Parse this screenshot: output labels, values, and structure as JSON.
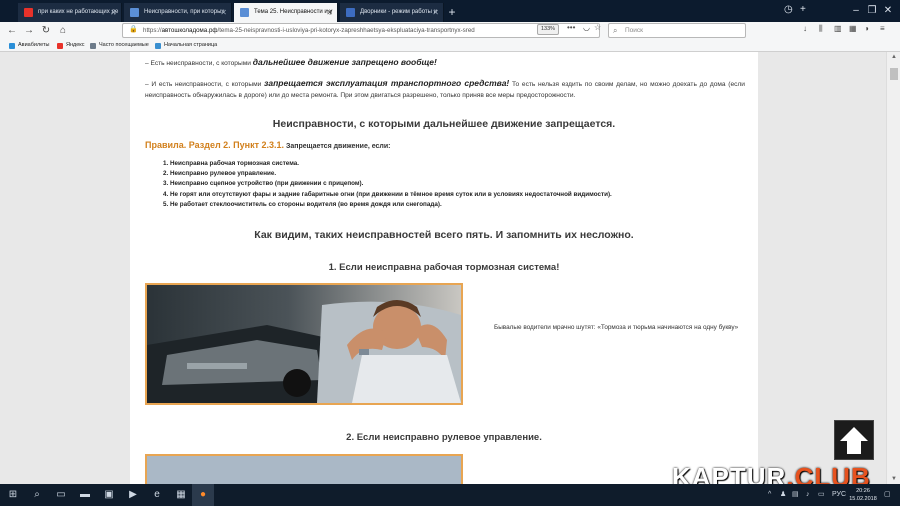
{
  "tabs": [
    {
      "label": "при каких не работающих де",
      "active": false,
      "favicon": "yandex-favicon",
      "color": "#e8322a"
    },
    {
      "label": "Неисправности, при которых",
      "active": false,
      "favicon": "site-favicon",
      "color": "#5b8fd6"
    },
    {
      "label": "Тема 25. Неисправности и у",
      "active": true,
      "favicon": "site-favicon",
      "color": "#5b8fd6"
    },
    {
      "label": "Дворники - режим работы и",
      "active": false,
      "favicon": "site-favicon",
      "color": "#3d6cc0"
    }
  ],
  "address_bar": {
    "protocol": "https://",
    "host": "автошколадома.рф",
    "path": "/tema-25-neispravnosti-i-usloviya-pri-kotoryx-zapreshhaetsya-ekspluataciya-transportnyx-sred",
    "zoom": "133%"
  },
  "search": {
    "placeholder": "Поиск"
  },
  "bookmarks": [
    {
      "label": "Авиабилеты",
      "color": "#2a8fd8"
    },
    {
      "label": "Яндекс",
      "color": "#e8322a"
    },
    {
      "label": "Часто посещаемые",
      "color": "#6d7b8a"
    },
    {
      "label": "Начальная страница",
      "color": "#3a8fd0"
    }
  ],
  "article": {
    "p1_prefix": "– Есть неисправности, с которыми ",
    "p1_em": "дальнейшее движение запрещено вообще!",
    "p2_prefix": "– И есть неисправности, с которыми ",
    "p2_em": "запрещается эксплуатация транспортного средства!",
    "p2_suffix": " То есть нельзя ездить по своим делам, но можно доехать до дома (если неисправность обнаружилась в дороге) или до места ремонта. При этом двигаться разрешено, только приняв все меры предосторожности.",
    "heading1": "Неисправности, с которыми дальнейшее движение запрещается.",
    "rule_label": "Правила. Раздел 2. Пункт 2.3.1.",
    "rule_text": " Запрещается движение, если:",
    "list": [
      "1. Неисправна рабочая тормозная система.",
      "2. Неисправно рулевое управление.",
      "3. Неисправно сцепное устройство (при движении с прицепом).",
      "4. Не горят или отсутствуют фары и задние габаритные огни (при движении в тёмное время суток или в условиях недостаточной видимости).",
      "5. Не работает стеклоочиститель со стороны водителя (во время дождя или снегопада)."
    ],
    "heading2": "Как видим, таких неисправностей всего пять. И запомнить их несложно.",
    "heading3": "1. Если неисправна рабочая тормозная система!",
    "caption": "Бывалые водители мрачно шутят: «Тормоза и тюрьма начинаются на одну букву»",
    "heading4": "2. Если неисправно рулевое управление."
  },
  "watermark": {
    "part1": "KAPTUR",
    "part2": ".CLUB"
  },
  "taskbar": {
    "lang": "РУС",
    "time": "20:26",
    "date": "15.02.2018"
  },
  "colors": {
    "accent_orange": "#d2801c",
    "photo_border": "#e8a552",
    "taskbar": "#0f1c2b",
    "tabbar": "#0c1b2e"
  }
}
